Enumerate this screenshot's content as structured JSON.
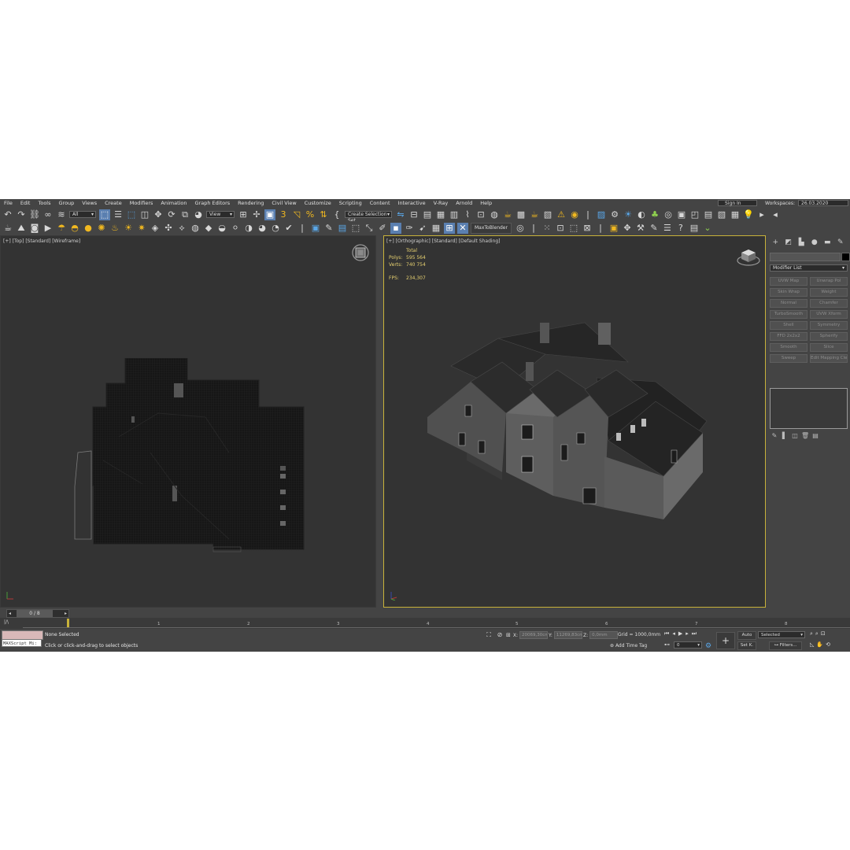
{
  "menu": [
    "File",
    "Edit",
    "Tools",
    "Group",
    "Views",
    "Create",
    "Modifiers",
    "Animation",
    "Graph Editors",
    "Rendering",
    "Civil View",
    "Customize",
    "Scripting",
    "Content",
    "Interactive",
    "V-Ray",
    "Arnold",
    "Help"
  ],
  "account": {
    "sign_in": "Sign In",
    "workspaces_label": "Workspaces:",
    "workspace_value": "26.03.2020"
  },
  "toolbar": {
    "filter_value": "All",
    "ref_coord_value": "View",
    "selection_set_value": "Create Selection Set",
    "maxtoblender_label": "MaxToBlender"
  },
  "viewports": {
    "left": {
      "label": "[+] [Top] [Standard] [Wireframe]"
    },
    "right": {
      "label": "[+] [Orthographic] [Standard] [Default Shading]",
      "stats": {
        "total_label": "Total",
        "polys_label": "Polys:",
        "polys_value": "595 564",
        "verts_label": "Verts:",
        "verts_value": "740 754",
        "fps_label": "FPS:",
        "fps_value": "234,307"
      }
    }
  },
  "command_panel": {
    "modifier_list_label": "Modifier List",
    "modifiers": [
      "UVW Map",
      "Unwrap Pol",
      "Skin Wrap",
      "Weight",
      "Normal",
      "Chamfer",
      "TurboSmooth",
      "UVW Xform",
      "Shell",
      "Symmetry",
      "FFD 2x2x2",
      "Spherify",
      "Smooth",
      "Slice",
      "Sweep",
      "Edit Mapping Cleaner"
    ]
  },
  "timeline": {
    "frame_label": "0 / 8",
    "key_label": "|/\\",
    "ticks": [
      "1",
      "2",
      "3",
      "4",
      "5",
      "6",
      "7",
      "8"
    ]
  },
  "status": {
    "maxscript_label": "MAXScript Mi:",
    "selection_status": "None Selected",
    "prompt": "Click or click-and-drag to select objects",
    "x_label": "X:",
    "x_value": "20069,30cm",
    "y_label": "Y:",
    "y_value": "11269,83cm",
    "z_label": "Z:",
    "z_value": "0,0mm",
    "grid": "Grid = 1000,0mm",
    "add_time_tag": "Add Time Tag",
    "auto_label": "Auto",
    "selected_dropdown": "Selected",
    "set_k_label": "Set K.",
    "filters_label": "Filters...",
    "frame_field": "0"
  }
}
